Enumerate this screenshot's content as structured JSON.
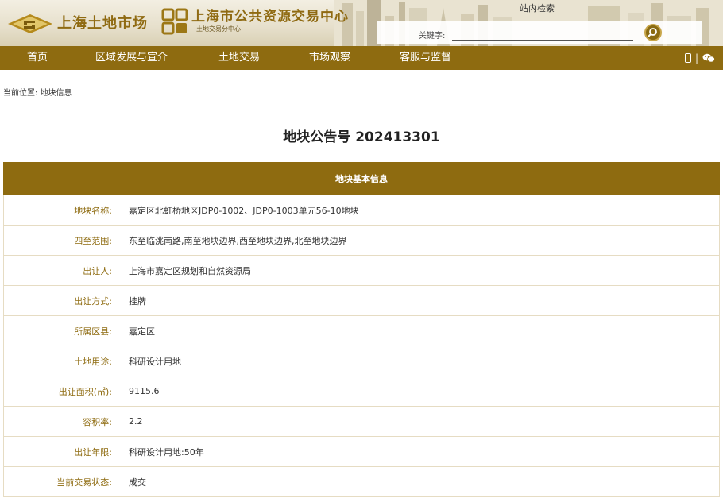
{
  "header": {
    "site_logo_text": "上海土地市场",
    "center_logo_text": "上海市公共资源交易中心",
    "center_logo_sub": "土地交易分中心",
    "search_tab_label": "站内检索",
    "search_keyword_label": "关键字:",
    "search_placeholder": "",
    "search_icon": "search-icon"
  },
  "nav": {
    "items": [
      "首页",
      "区域发展与宣介",
      "土地交易",
      "市场观察",
      "客服与监督"
    ],
    "separator": "|",
    "icons": [
      "mobile-icon",
      "wechat-icon"
    ]
  },
  "breadcrumb": {
    "prefix": "当前位置:",
    "current": "地块信息"
  },
  "page_title": "地块公告号 202413301",
  "table": {
    "header": "地块基本信息",
    "rows": [
      {
        "label": "地块名称:",
        "value": "嘉定区北虹桥地区JDP0-1002、JDP0-1003单元56-10地块"
      },
      {
        "label": "四至范围:",
        "value": "东至临洮南路,南至地块边界,西至地块边界,北至地块边界"
      },
      {
        "label": "出让人:",
        "value": "上海市嘉定区规划和自然资源局"
      },
      {
        "label": "出让方式:",
        "value": "挂牌"
      },
      {
        "label": "所属区县:",
        "value": "嘉定区"
      },
      {
        "label": "土地用途:",
        "value": "科研设计用地"
      },
      {
        "label": "出让面积(㎡):",
        "value": "9115.6"
      },
      {
        "label": "容积率:",
        "value": "2.2"
      },
      {
        "label": "出让年限:",
        "value": "科研设计用地:50年"
      },
      {
        "label": "当前交易状态:",
        "value": "成交"
      }
    ]
  },
  "colors": {
    "brand": "#8e6b10",
    "label": "#8e6b10",
    "border": "#e6dcc3"
  }
}
